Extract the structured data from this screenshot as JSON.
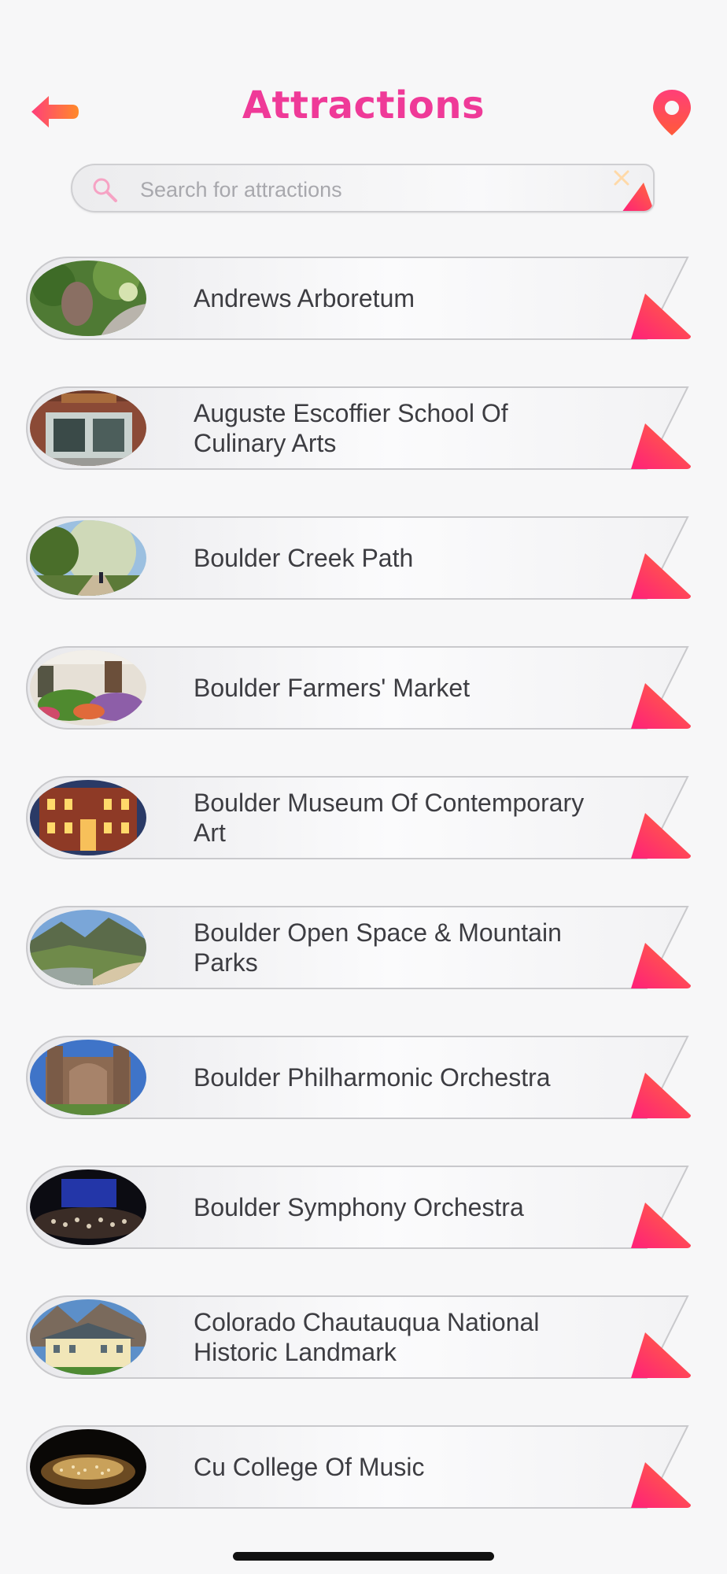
{
  "header": {
    "title": "Attractions",
    "back_icon": "back-arrow-icon",
    "map_icon": "location-pin-icon"
  },
  "search": {
    "placeholder": "Search for attractions",
    "value": "",
    "search_icon": "search-icon",
    "clear_icon": "close-icon"
  },
  "colors": {
    "accent": "#ef3a98",
    "accent_gradient_start": "#ff2e7a",
    "accent_gradient_end": "#ff7a2e",
    "back_arrow": "#ff6a2a",
    "background": "#f7f7f8",
    "text": "#3d3d42"
  },
  "attractions": [
    {
      "label": "Andrews Arboretum",
      "thumb": "forest-photo"
    },
    {
      "label": "Auguste Escoffier School Of Culinary Arts",
      "thumb": "storefront-photo"
    },
    {
      "label": "Boulder Creek Path",
      "thumb": "trees-path-photo"
    },
    {
      "label": "Boulder Farmers' Market",
      "thumb": "market-produce-photo"
    },
    {
      "label": "Boulder Museum Of Contemporary Art",
      "thumb": "brick-building-photo"
    },
    {
      "label": "Boulder Open Space & Mountain Parks",
      "thumb": "mountain-valley-photo"
    },
    {
      "label": "Boulder Philharmonic Orchestra",
      "thumb": "concert-hall-building-photo"
    },
    {
      "label": "Boulder Symphony Orchestra",
      "thumb": "orchestra-stage-photo"
    },
    {
      "label": "Colorado Chautauqua National Historic Landmark",
      "thumb": "historic-lodge-photo"
    },
    {
      "label": "Cu College Of Music",
      "thumb": "concert-audience-photo"
    }
  ]
}
